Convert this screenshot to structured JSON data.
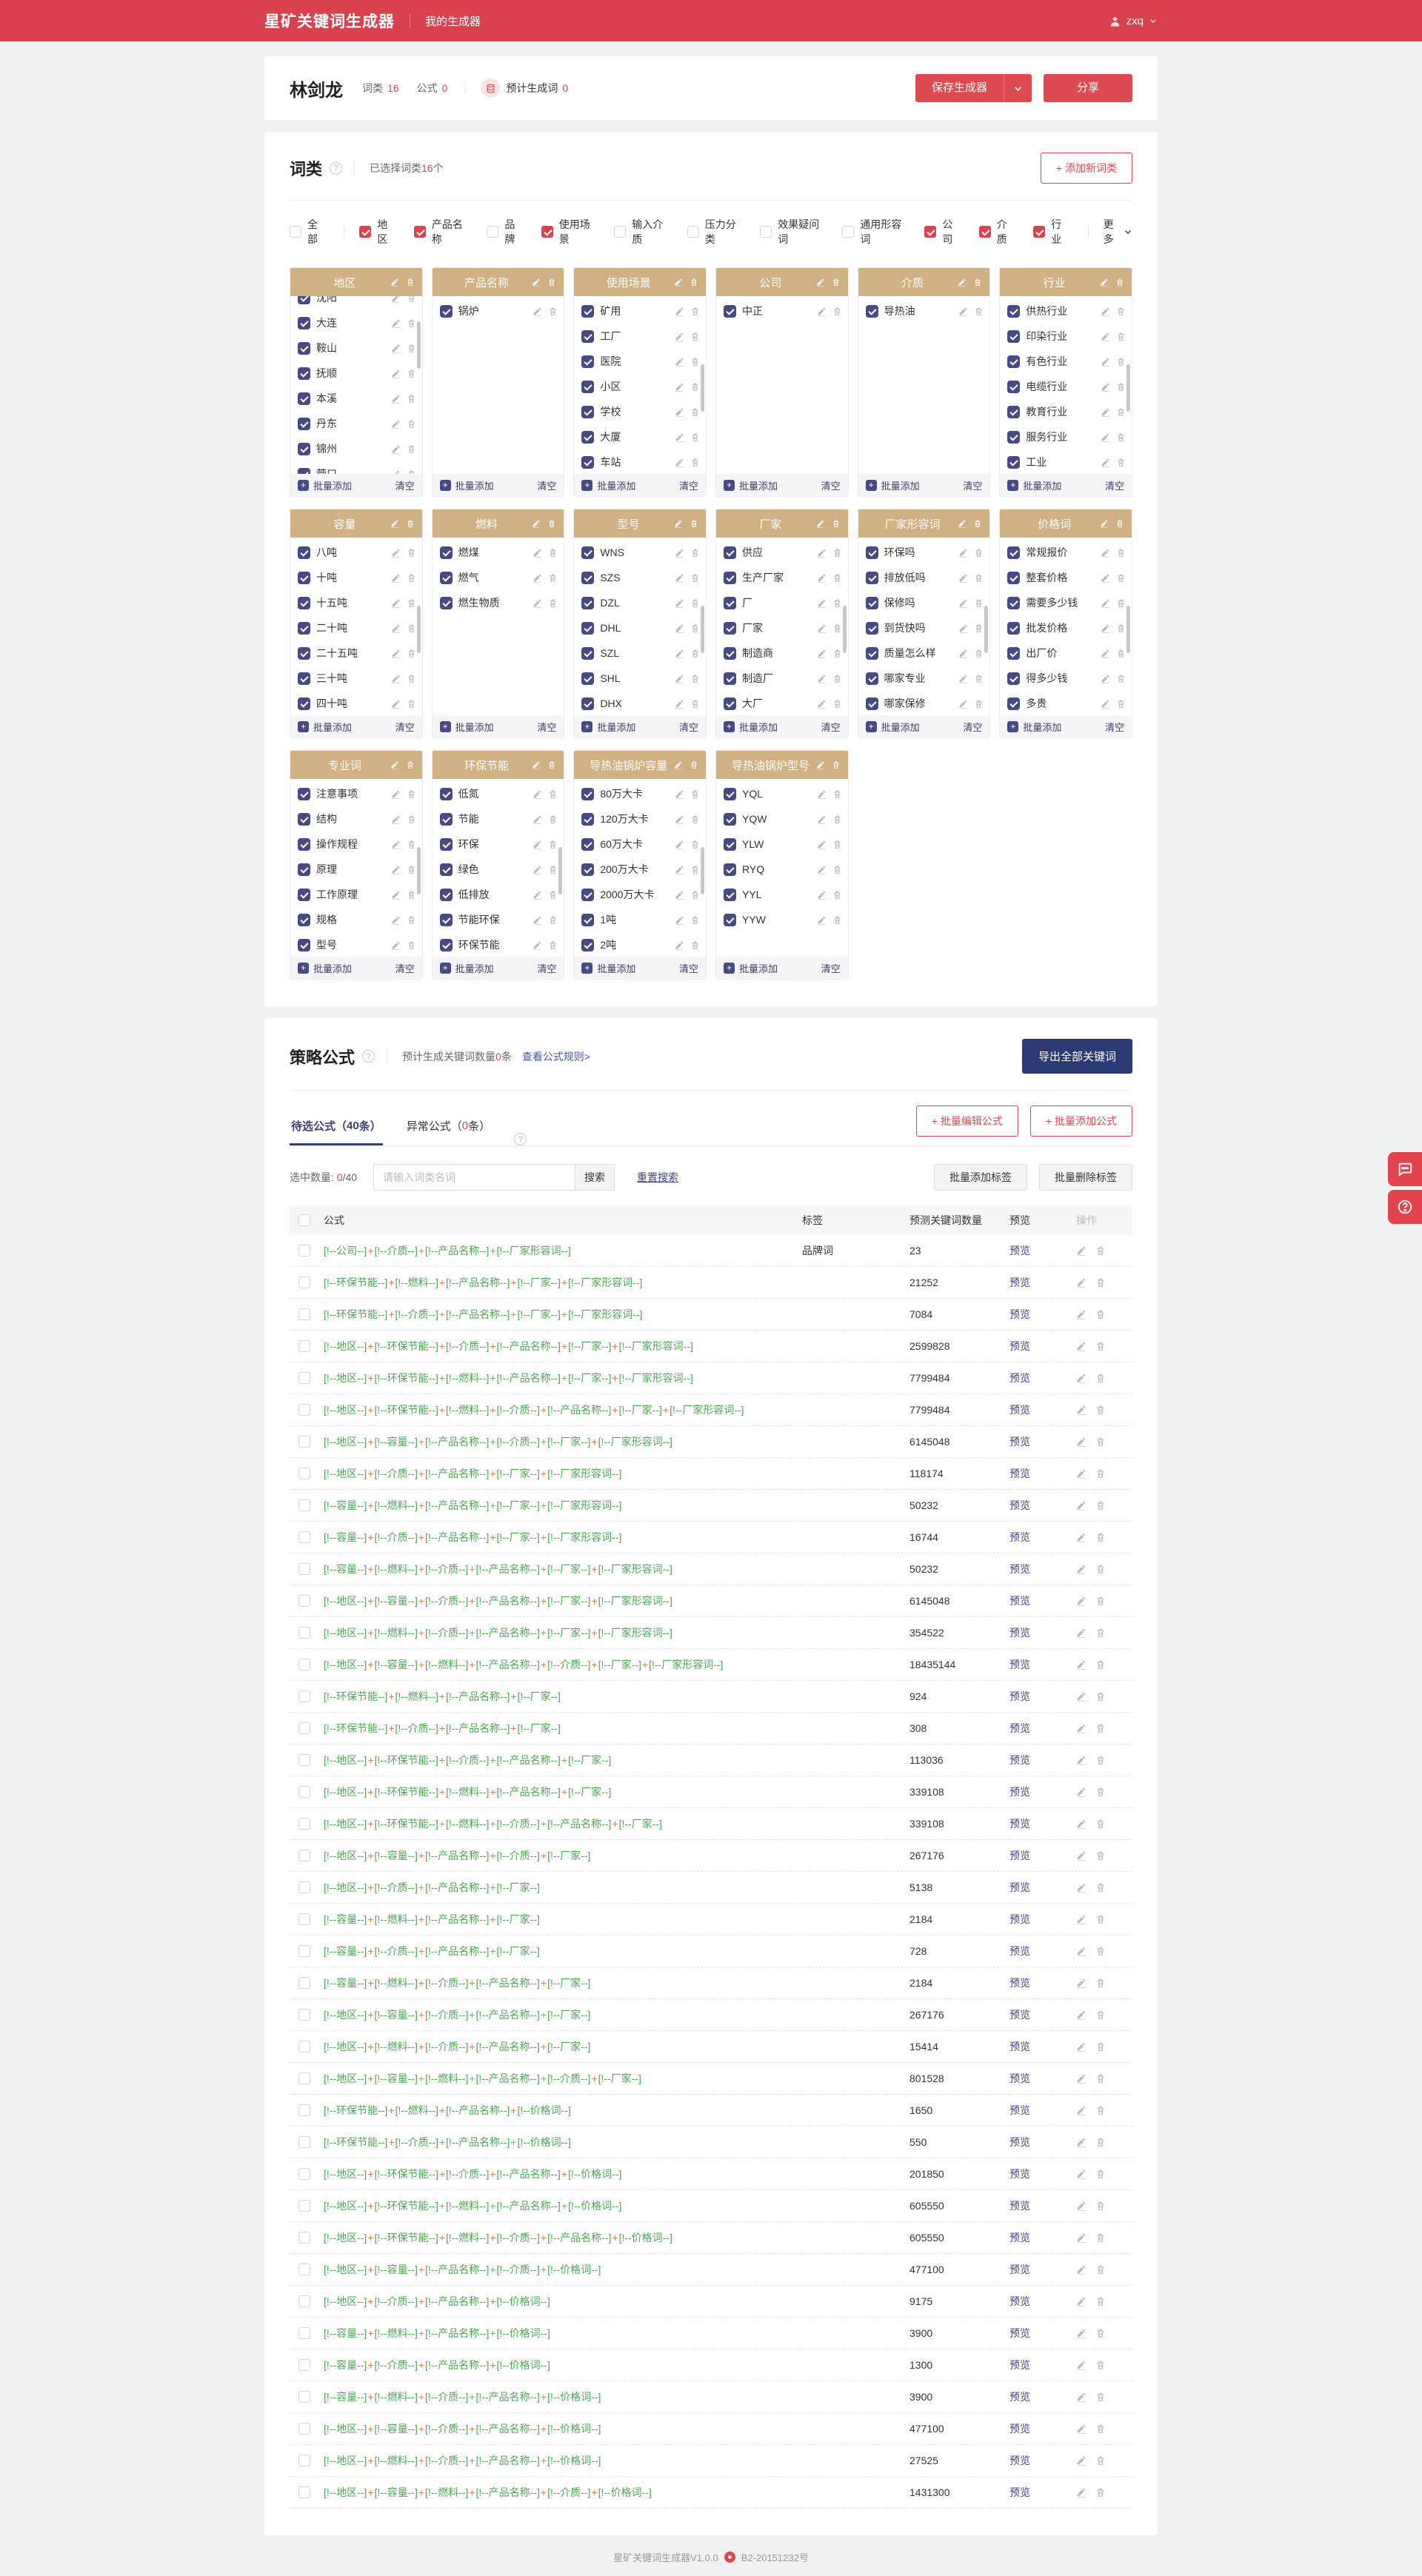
{
  "topbar": {
    "logo": "星矿关键词生成器",
    "nav": "我的生成器",
    "user": "zxq"
  },
  "titlebar": {
    "name": "林剑龙",
    "stats": [
      {
        "label": "词类",
        "value": "16"
      },
      {
        "label": "公式",
        "value": "0"
      }
    ],
    "estimate_label": "预计生成词",
    "estimate_value": "0",
    "save_button": "保存生成器",
    "share_button": "分享"
  },
  "categories": {
    "title": "词类",
    "selected_prefix": "已选择词类",
    "selected_count": "16",
    "selected_suffix": "个",
    "add_button": "+ 添加新词类",
    "filters": [
      {
        "label": "全部",
        "checked": false,
        "sep_after": true
      },
      {
        "label": "地区",
        "checked": true
      },
      {
        "label": "产品名称",
        "checked": true
      },
      {
        "label": "品牌",
        "checked": false
      },
      {
        "label": "使用场景",
        "checked": true
      },
      {
        "label": "输入介质",
        "checked": false
      },
      {
        "label": "压力分类",
        "checked": false
      },
      {
        "label": "效果疑问词",
        "checked": false
      },
      {
        "label": "通用形容词",
        "checked": false
      },
      {
        "label": "公司",
        "checked": true
      },
      {
        "label": "介质",
        "checked": true
      },
      {
        "label": "行业",
        "checked": true,
        "sep_after": true
      }
    ],
    "more_label": "更多",
    "card_footer": {
      "add": "批量添加",
      "clear": "清空"
    },
    "cards": [
      {
        "title": "地区",
        "items": [
          "沈阳",
          "大连",
          "鞍山",
          "抚顺",
          "本溪",
          "丹东",
          "锦州",
          "营口"
        ],
        "scrollbar": true,
        "scrolled": true
      },
      {
        "title": "产品名称",
        "items": [
          "锅炉"
        ],
        "scrollbar": false,
        "scrolled": false
      },
      {
        "title": "使用场景",
        "items": [
          "矿用",
          "工厂",
          "医院",
          "小区",
          "学校",
          "大厦",
          "车站"
        ],
        "scrollbar": true,
        "scrolled": false
      },
      {
        "title": "公司",
        "items": [
          "中正"
        ],
        "scrollbar": false,
        "scrolled": false
      },
      {
        "title": "介质",
        "items": [
          "导热油"
        ],
        "scrollbar": false,
        "scrolled": false
      },
      {
        "title": "行业",
        "items": [
          "供热行业",
          "印染行业",
          "有色行业",
          "电缆行业",
          "教育行业",
          "服务行业",
          "工业"
        ],
        "scrollbar": true,
        "scrolled": false
      },
      {
        "title": "容量",
        "items": [
          "八吨",
          "十吨",
          "十五吨",
          "二十吨",
          "二十五吨",
          "三十吨",
          "四十吨"
        ],
        "scrollbar": true,
        "scrolled": false
      },
      {
        "title": "燃料",
        "items": [
          "燃煤",
          "燃气",
          "燃生物质"
        ],
        "scrollbar": false,
        "scrolled": false
      },
      {
        "title": "型号",
        "items": [
          "WNS",
          "SZS",
          "DZL",
          "DHL",
          "SZL",
          "SHL",
          "DHX"
        ],
        "scrollbar": true,
        "scrolled": false
      },
      {
        "title": "厂家",
        "items": [
          "供应",
          "生产厂家",
          "厂",
          "厂家",
          "制造商",
          "制造厂",
          "大厂"
        ],
        "scrollbar": true,
        "scrolled": false
      },
      {
        "title": "厂家形容词",
        "items": [
          "环保吗",
          "排放低吗",
          "保修吗",
          "到货快吗",
          "质量怎么样",
          "哪家专业",
          "哪家保修"
        ],
        "scrollbar": true,
        "scrolled": false
      },
      {
        "title": "价格词",
        "items": [
          "常规报价",
          "整套价格",
          "需要多少钱",
          "批发价格",
          "出厂价",
          "得多少钱",
          "多贵"
        ],
        "scrollbar": true,
        "scrolled": false
      },
      {
        "title": "专业词",
        "items": [
          "注意事项",
          "结构",
          "操作规程",
          "原理",
          "工作原理",
          "规格",
          "型号"
        ],
        "scrollbar": true,
        "scrolled": false
      },
      {
        "title": "环保节能",
        "items": [
          "低氮",
          "节能",
          "环保",
          "绿色",
          "低排放",
          "节能环保",
          "环保节能"
        ],
        "scrollbar": true,
        "scrolled": false
      },
      {
        "title": "导热油锅炉容量",
        "items": [
          "80万大卡",
          "120万大卡",
          "60万大卡",
          "200万大卡",
          "2000万大卡",
          "1吨",
          "2吨"
        ],
        "scrollbar": true,
        "scrolled": false
      },
      {
        "title": "导热油锅炉型号",
        "items": [
          "YQL",
          "YQW",
          "YLW",
          "RYQ",
          "YYL",
          "YYW"
        ],
        "scrollbar": false,
        "scrolled": false
      }
    ]
  },
  "formulas": {
    "title": "策略公式",
    "note_prefix": "预计生成关键词数量",
    "note_count": "0",
    "note_suffix": "条",
    "rules_link": "查看公式规则>",
    "export_button": "导出全部关键词",
    "tabs": [
      {
        "prefix": "待选公式（",
        "count": "40",
        "suffix": "条）",
        "active": true,
        "count_red": false
      },
      {
        "prefix": "异常公式（",
        "count": "0",
        "suffix": "条）",
        "active": false,
        "count_red": true
      }
    ],
    "batch_edit_button": "+ 批量编辑公式",
    "batch_add_button": "+ 批量添加公式",
    "selected_label": "选中数量:",
    "selected_red": "0",
    "selected_rest": "/40",
    "search_placeholder": "请输入词类名词",
    "search_button": "搜索",
    "reset_button": "重置搜索",
    "tag_add_button": "批量添加标签",
    "tag_delete_button": "批量删除标签",
    "table": {
      "headers": [
        "公式",
        "标签",
        "预测关键词数量",
        "预览",
        "操作"
      ],
      "token_prefix": "[!--",
      "token_suffix": "--]",
      "joiner": "+",
      "preview_label": "预览",
      "rows": [
        {
          "parts": [
            "公司",
            "介质",
            "产品名称",
            "厂家形容词"
          ],
          "tag": "品牌词",
          "count": "23"
        },
        {
          "parts": [
            "环保节能",
            "燃料",
            "产品名称",
            "厂家",
            "厂家形容词"
          ],
          "tag": "",
          "count": "21252"
        },
        {
          "parts": [
            "环保节能",
            "介质",
            "产品名称",
            "厂家",
            "厂家形容词"
          ],
          "tag": "",
          "count": "7084"
        },
        {
          "parts": [
            "地区",
            "环保节能",
            "介质",
            "产品名称",
            "厂家",
            "厂家形容词"
          ],
          "tag": "",
          "count": "2599828"
        },
        {
          "parts": [
            "地区",
            "环保节能",
            "燃料",
            "产品名称",
            "厂家",
            "厂家形容词"
          ],
          "tag": "",
          "count": "7799484"
        },
        {
          "parts": [
            "地区",
            "环保节能",
            "燃料",
            "介质",
            "产品名称",
            "厂家",
            "厂家形容词"
          ],
          "tag": "",
          "count": "7799484"
        },
        {
          "parts": [
            "地区",
            "容量",
            "产品名称",
            "介质",
            "厂家",
            "厂家形容词"
          ],
          "tag": "",
          "count": "6145048"
        },
        {
          "parts": [
            "地区",
            "介质",
            "产品名称",
            "厂家",
            "厂家形容词"
          ],
          "tag": "",
          "count": "118174"
        },
        {
          "parts": [
            "容量",
            "燃料",
            "产品名称",
            "厂家",
            "厂家形容词"
          ],
          "tag": "",
          "count": "50232"
        },
        {
          "parts": [
            "容量",
            "介质",
            "产品名称",
            "厂家",
            "厂家形容词"
          ],
          "tag": "",
          "count": "16744"
        },
        {
          "parts": [
            "容量",
            "燃料",
            "介质",
            "产品名称",
            "厂家",
            "厂家形容词"
          ],
          "tag": "",
          "count": "50232"
        },
        {
          "parts": [
            "地区",
            "容量",
            "介质",
            "产品名称",
            "厂家",
            "厂家形容词"
          ],
          "tag": "",
          "count": "6145048"
        },
        {
          "parts": [
            "地区",
            "燃料",
            "介质",
            "产品名称",
            "厂家",
            "厂家形容词"
          ],
          "tag": "",
          "count": "354522"
        },
        {
          "parts": [
            "地区",
            "容量",
            "燃料",
            "产品名称",
            "介质",
            "厂家",
            "厂家形容词"
          ],
          "tag": "",
          "count": "18435144"
        },
        {
          "parts": [
            "环保节能",
            "燃料",
            "产品名称",
            "厂家"
          ],
          "tag": "",
          "count": "924"
        },
        {
          "parts": [
            "环保节能",
            "介质",
            "产品名称",
            "厂家"
          ],
          "tag": "",
          "count": "308"
        },
        {
          "parts": [
            "地区",
            "环保节能",
            "介质",
            "产品名称",
            "厂家"
          ],
          "tag": "",
          "count": "113036"
        },
        {
          "parts": [
            "地区",
            "环保节能",
            "燃料",
            "产品名称",
            "厂家"
          ],
          "tag": "",
          "count": "339108"
        },
        {
          "parts": [
            "地区",
            "环保节能",
            "燃料",
            "介质",
            "产品名称",
            "厂家"
          ],
          "tag": "",
          "count": "339108"
        },
        {
          "parts": [
            "地区",
            "容量",
            "产品名称",
            "介质",
            "厂家"
          ],
          "tag": "",
          "count": "267176"
        },
        {
          "parts": [
            "地区",
            "介质",
            "产品名称",
            "厂家"
          ],
          "tag": "",
          "count": "5138"
        },
        {
          "parts": [
            "容量",
            "燃料",
            "产品名称",
            "厂家"
          ],
          "tag": "",
          "count": "2184"
        },
        {
          "parts": [
            "容量",
            "介质",
            "产品名称",
            "厂家"
          ],
          "tag": "",
          "count": "728"
        },
        {
          "parts": [
            "容量",
            "燃料",
            "介质",
            "产品名称",
            "厂家"
          ],
          "tag": "",
          "count": "2184"
        },
        {
          "parts": [
            "地区",
            "容量",
            "介质",
            "产品名称",
            "厂家"
          ],
          "tag": "",
          "count": "267176"
        },
        {
          "parts": [
            "地区",
            "燃料",
            "介质",
            "产品名称",
            "厂家"
          ],
          "tag": "",
          "count": "15414"
        },
        {
          "parts": [
            "地区",
            "容量",
            "燃料",
            "产品名称",
            "介质",
            "厂家"
          ],
          "tag": "",
          "count": "801528"
        },
        {
          "parts": [
            "环保节能",
            "燃料",
            "产品名称",
            "价格词"
          ],
          "tag": "",
          "count": "1650"
        },
        {
          "parts": [
            "环保节能",
            "介质",
            "产品名称",
            "价格词"
          ],
          "tag": "",
          "count": "550"
        },
        {
          "parts": [
            "地区",
            "环保节能",
            "介质",
            "产品名称",
            "价格词"
          ],
          "tag": "",
          "count": "201850"
        },
        {
          "parts": [
            "地区",
            "环保节能",
            "燃料",
            "产品名称",
            "价格词"
          ],
          "tag": "",
          "count": "605550"
        },
        {
          "parts": [
            "地区",
            "环保节能",
            "燃料",
            "介质",
            "产品名称",
            "价格词"
          ],
          "tag": "",
          "count": "605550"
        },
        {
          "parts": [
            "地区",
            "容量",
            "产品名称",
            "介质",
            "价格词"
          ],
          "tag": "",
          "count": "477100"
        },
        {
          "parts": [
            "地区",
            "介质",
            "产品名称",
            "价格词"
          ],
          "tag": "",
          "count": "9175"
        },
        {
          "parts": [
            "容量",
            "燃料",
            "产品名称",
            "价格词"
          ],
          "tag": "",
          "count": "3900"
        },
        {
          "parts": [
            "容量",
            "介质",
            "产品名称",
            "价格词"
          ],
          "tag": "",
          "count": "1300"
        },
        {
          "parts": [
            "容量",
            "燃料",
            "介质",
            "产品名称",
            "价格词"
          ],
          "tag": "",
          "count": "3900"
        },
        {
          "parts": [
            "地区",
            "容量",
            "介质",
            "产品名称",
            "价格词"
          ],
          "tag": "",
          "count": "477100"
        },
        {
          "parts": [
            "地区",
            "燃料",
            "介质",
            "产品名称",
            "价格词"
          ],
          "tag": "",
          "count": "27525"
        },
        {
          "parts": [
            "地区",
            "容量",
            "燃料",
            "产品名称",
            "介质",
            "价格词"
          ],
          "tag": "",
          "count": "1431300"
        }
      ]
    }
  },
  "footer": {
    "version": "星矿关键词生成器V1.0.0",
    "icp": "B2-20151232号"
  },
  "icons": {
    "user": "user-icon",
    "caret": "chevron-down-icon",
    "database": "database-icon",
    "help": "question-circle-icon",
    "edit": "pencil-icon",
    "delete": "trash-icon",
    "add": "plus-icon",
    "chat": "chat-bubble-icon",
    "question": "question-circle-icon",
    "beian": "badge-dot-icon"
  },
  "colors": {
    "brand_red": "#d9414e",
    "accent_red": "#e2434d",
    "navy_button": "#2c3a74",
    "tab_navy": "#3a3f79",
    "card_header_tan": "#cfb183",
    "item_indigo": "#484a86",
    "formula_green": "#4aa850",
    "formula_plus_orange": "#ed7b45"
  }
}
